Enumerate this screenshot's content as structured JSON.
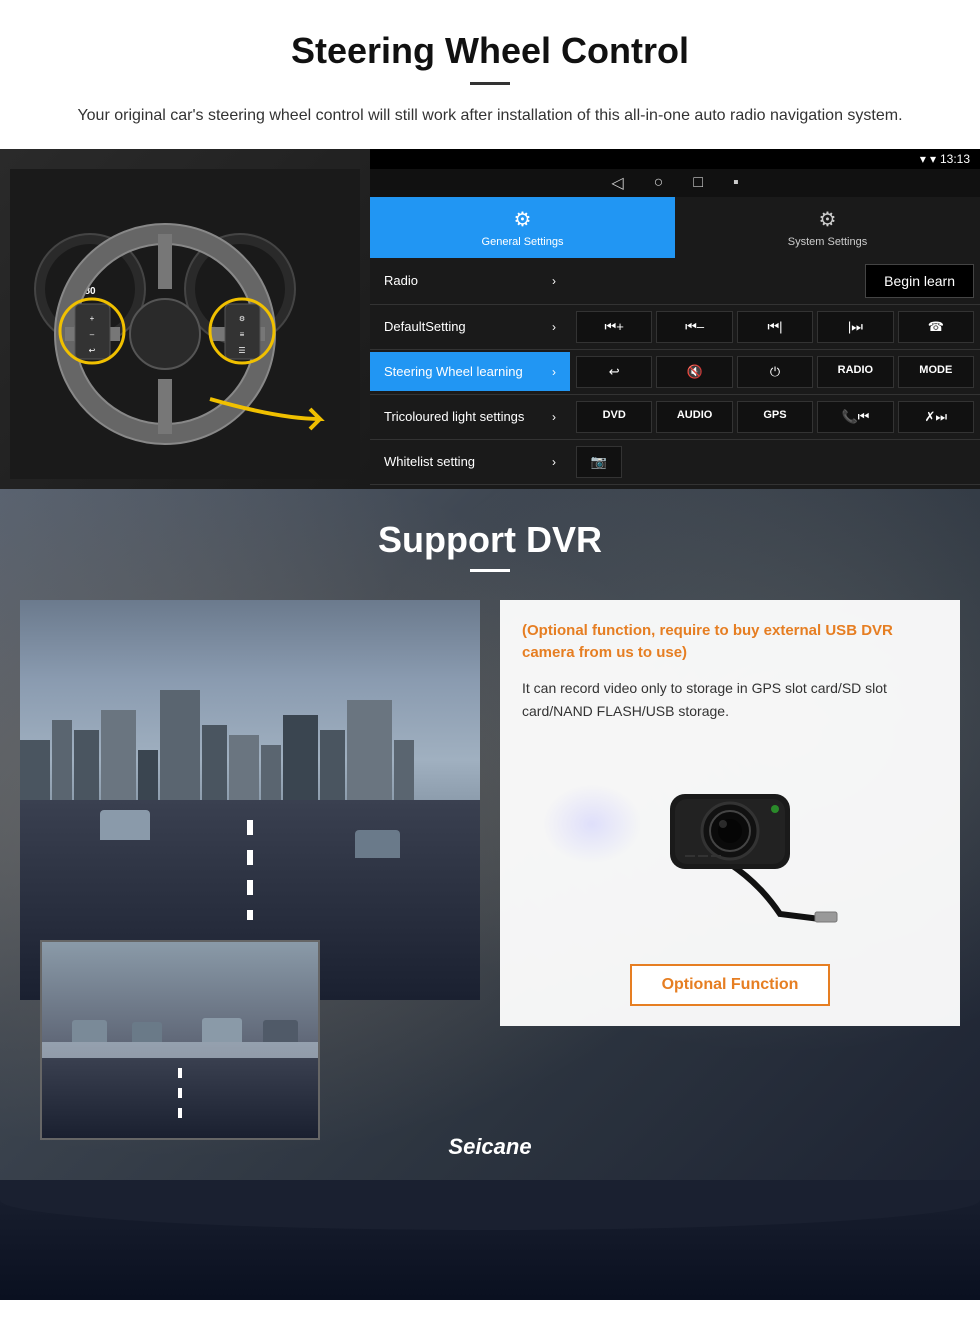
{
  "page": {
    "section1": {
      "title": "Steering Wheel Control",
      "subtitle": "Your original car's steering wheel control will still work after installation of this all-in-one auto radio navigation system.",
      "android": {
        "statusbar": {
          "time": "13:13",
          "signal_icon": "▾",
          "wifi_icon": "▾"
        },
        "nav_icons": [
          "◁",
          "○",
          "□",
          "▪"
        ],
        "tabs": [
          {
            "label": "General Settings",
            "icon": "⚙",
            "active": true
          },
          {
            "label": "System Settings",
            "icon": "⚙",
            "active": false
          }
        ],
        "menu_items": [
          {
            "label": "Radio",
            "active": false,
            "has_chevron": true
          },
          {
            "label": "DefaultSetting",
            "active": false,
            "has_chevron": true
          },
          {
            "label": "Steering Wheel learning",
            "active": true,
            "has_chevron": true
          },
          {
            "label": "Tricoloured light settings",
            "active": false,
            "has_chevron": true
          },
          {
            "label": "Whitelist setting",
            "active": false,
            "has_chevron": true
          }
        ],
        "begin_learn_label": "Begin learn",
        "control_buttons": [
          "⏮+",
          "⏮–",
          "⏮|",
          "|⏭",
          "☎",
          "↩",
          "🔇",
          "⏻",
          "RADIO",
          "MODE",
          "DVD",
          "AUDIO",
          "GPS",
          "📞⏮|",
          "✗⏭"
        ]
      }
    },
    "section2": {
      "title": "Support DVR",
      "optional_text": "(Optional function, require to buy external USB DVR camera from us to use)",
      "desc_text": "It can record video only to storage in GPS slot card/SD slot card/NAND FLASH/USB storage.",
      "optional_function_label": "Optional Function",
      "brand": "Seicane"
    }
  }
}
